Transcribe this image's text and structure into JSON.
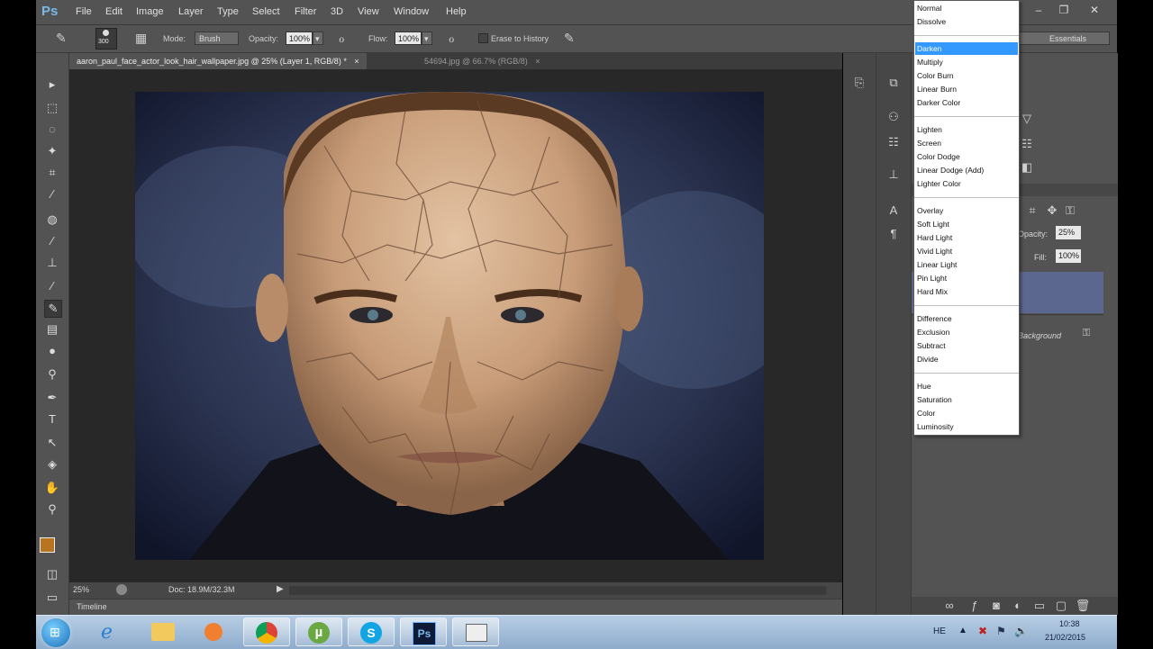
{
  "app": {
    "logo": "Ps"
  },
  "menu": [
    "File",
    "Edit",
    "Image",
    "Layer",
    "Type",
    "Select",
    "Filter",
    "3D",
    "View",
    "Window",
    "Help"
  ],
  "window_controls": {
    "minimize": "–",
    "restore": "❐",
    "close": "✕"
  },
  "options": {
    "brush_size": "300",
    "mode_label": "Mode:",
    "mode_value": "Brush",
    "opacity_label": "Opacity:",
    "opacity_value": "100%",
    "flow_label": "Flow:",
    "flow_value": "100%",
    "erase_history_label": "Erase to History",
    "workspace_value": "Essentials"
  },
  "tabs": [
    {
      "label": "aaron_paul_face_actor_look_hair_wallpaper.jpg @ 25% (Layer 1, RGB/8) *",
      "close": "×"
    },
    {
      "label": "54694.jpg @ 66.7% (RGB/8)",
      "close": "×"
    }
  ],
  "status": {
    "zoom": "25%",
    "doc": "Doc: 18.9M/32.3M"
  },
  "timeline": {
    "label": "Timeline"
  },
  "layers_panel": {
    "opacity_label": "Opacity:",
    "opacity_value": "25%",
    "fill_label": "Fill:",
    "fill_value": "100%",
    "background_label": "Background"
  },
  "blend_modes": {
    "selected": "Darken",
    "groups": [
      [
        "Normal",
        "Dissolve"
      ],
      [
        "Darken",
        "Multiply",
        "Color Burn",
        "Linear Burn",
        "Darker Color"
      ],
      [
        "Lighten",
        "Screen",
        "Color Dodge",
        "Linear Dodge (Add)",
        "Lighter Color"
      ],
      [
        "Overlay",
        "Soft Light",
        "Hard Light",
        "Vivid Light",
        "Linear Light",
        "Pin Light",
        "Hard Mix"
      ],
      [
        "Difference",
        "Exclusion",
        "Subtract",
        "Divide"
      ],
      [
        "Hue",
        "Saturation",
        "Color",
        "Luminosity"
      ]
    ]
  },
  "taskbar": {
    "language": "HE",
    "time": "10:38",
    "date": "21/02/2015",
    "ps_label": "Ps"
  },
  "colors": {
    "foreground": "#b8741e",
    "background": "#ffffff",
    "selection": "#3399ff"
  }
}
